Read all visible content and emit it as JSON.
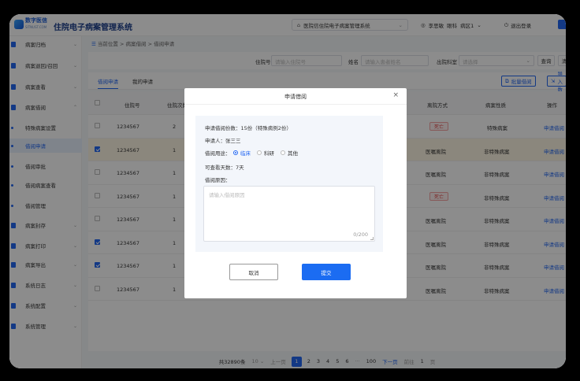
{
  "header": {
    "logo_main": "数字医信",
    "logo_sub": "SITNUST.COM",
    "app_title": "住院电子病案管理系统",
    "system_select": "医院信住院电子病案管理系统",
    "user": "李思敏",
    "dept": "眼科",
    "ward": "病区1",
    "logout": "退出登录"
  },
  "sidebar": {
    "items": [
      {
        "label": "病案归档",
        "type": "parent"
      },
      {
        "label": "病案退回/召回",
        "type": "parent"
      },
      {
        "label": "病案查看",
        "type": "parent"
      },
      {
        "label": "病案借阅",
        "type": "parent-open"
      },
      {
        "label": "特殊病案设置",
        "type": "sub"
      },
      {
        "label": "借阅申请",
        "type": "sub-active"
      },
      {
        "label": "借阅审批",
        "type": "sub"
      },
      {
        "label": "借阅病案查看",
        "type": "sub"
      },
      {
        "label": "借阅管理",
        "type": "sub"
      },
      {
        "label": "病案封存",
        "type": "parent"
      },
      {
        "label": "病案打印",
        "type": "parent"
      },
      {
        "label": "病案导出",
        "type": "parent"
      },
      {
        "label": "系统日志",
        "type": "parent"
      },
      {
        "label": "系统配置",
        "type": "parent"
      },
      {
        "label": "系统管理",
        "type": "parent"
      }
    ]
  },
  "breadcrumb": {
    "home": "当前位置",
    "level1": "病案借阅",
    "level2": "借阅申请"
  },
  "filter": {
    "inpatient_no_label": "住院号",
    "inpatient_no_placeholder": "请输入住院号",
    "name_label": "姓名",
    "name_placeholder": "请输入患者姓名",
    "dept_label": "出院科室",
    "dept_placeholder": "请选择",
    "search_btn": "查询",
    "reset_btn": "清"
  },
  "tabs": {
    "tab1": "借阅申请",
    "tab2": "我的申请",
    "batch_btn": "批量借阅",
    "import_btn": "导入数"
  },
  "table": {
    "headers": {
      "inpatient_no": "住院号",
      "times": "住院次数",
      "discharge": "离院方式",
      "nature": "病案性质",
      "action": "操作"
    },
    "rows": [
      {
        "no": "1234567",
        "times": "2",
        "discharge": "死亡",
        "nature": "特殊病案",
        "action": "申请借阅",
        "checked": false
      },
      {
        "no": "1234567",
        "times": "1",
        "discharge": "医嘱离院",
        "nature": "非特殊病案",
        "action": "申请借阅",
        "checked": true
      },
      {
        "no": "1234567",
        "times": "1",
        "discharge": "医嘱离院",
        "nature": "非特殊病案",
        "action": "申请借阅",
        "checked": false
      },
      {
        "no": "1234567",
        "times": "1",
        "discharge": "死亡",
        "nature": "非特殊病案",
        "action": "申请借阅",
        "checked": false
      },
      {
        "no": "1234567",
        "times": "1",
        "discharge": "医嘱离院",
        "nature": "非特殊病案",
        "action": "申请借阅",
        "checked": false
      },
      {
        "no": "1234567",
        "times": "1",
        "discharge": "医嘱离院",
        "nature": "非特殊病案",
        "action": "申请借阅",
        "checked": true
      },
      {
        "no": "1234567",
        "times": "1",
        "discharge": "医嘱离院",
        "nature": "非特殊病案",
        "action": "申请借阅",
        "checked": true
      },
      {
        "no": "1234567",
        "times": "1",
        "discharge": "医嘱离院",
        "nature": "非特殊病案",
        "action": "申请借阅",
        "checked": false
      }
    ]
  },
  "pager": {
    "total": "共32890条",
    "size": "10",
    "prev": "上一页",
    "pages": [
      "1",
      "2",
      "3",
      "4",
      "5",
      "6"
    ],
    "ellipsis": "···",
    "last": "100",
    "next": "下一页",
    "goto": "前往",
    "goto_value": "1",
    "page_unit": "页"
  },
  "modal": {
    "title": "申请借阅",
    "close": "×",
    "count_line": "申请借阅份数：15份（特殊病例2份）",
    "applicant_line": "申请人：张三三",
    "purpose_label": "借阅用途：",
    "purposes": [
      "临床",
      "科研",
      "其他"
    ],
    "days_line": "可查看天数：7天",
    "reason_label": "借阅原因：",
    "reason_placeholder": "请输入借阅原因",
    "counter": "0/200",
    "cancel": "取消",
    "submit": "提交"
  },
  "colors": {
    "primary": "#2468f2",
    "danger": "#e34d4d"
  }
}
